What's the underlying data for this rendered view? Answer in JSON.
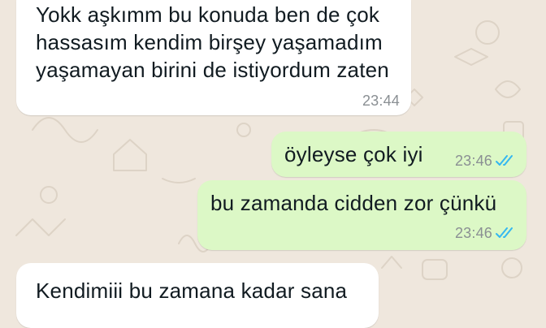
{
  "chat": {
    "messages": [
      {
        "direction": "incoming",
        "lines": [
          "Yokk aşkımm bu konuda ben de çok",
          "hassasım kendim birşey yaşamadım",
          "yaşamayan birini de istiyordum zaten"
        ],
        "time": "23:44"
      },
      {
        "direction": "outgoing",
        "lines": [
          "öyleyse çok iyi"
        ],
        "time": "23:46",
        "status_icon": "double-check-read-icon"
      },
      {
        "direction": "outgoing",
        "lines": [
          "bu zamanda cidden zor çünkü"
        ],
        "time": "23:46",
        "status_icon": "double-check-read-icon"
      },
      {
        "direction": "incoming",
        "lines": [
          "Kendimiii bu zamana kadar sana"
        ],
        "time": ""
      }
    ]
  },
  "colors": {
    "background": "#efe7dd",
    "incoming_bubble": "#ffffff",
    "outgoing_bubble": "#dcf8c6",
    "read_ticks": "#34b7f1",
    "timestamp": "#8a8f93"
  }
}
